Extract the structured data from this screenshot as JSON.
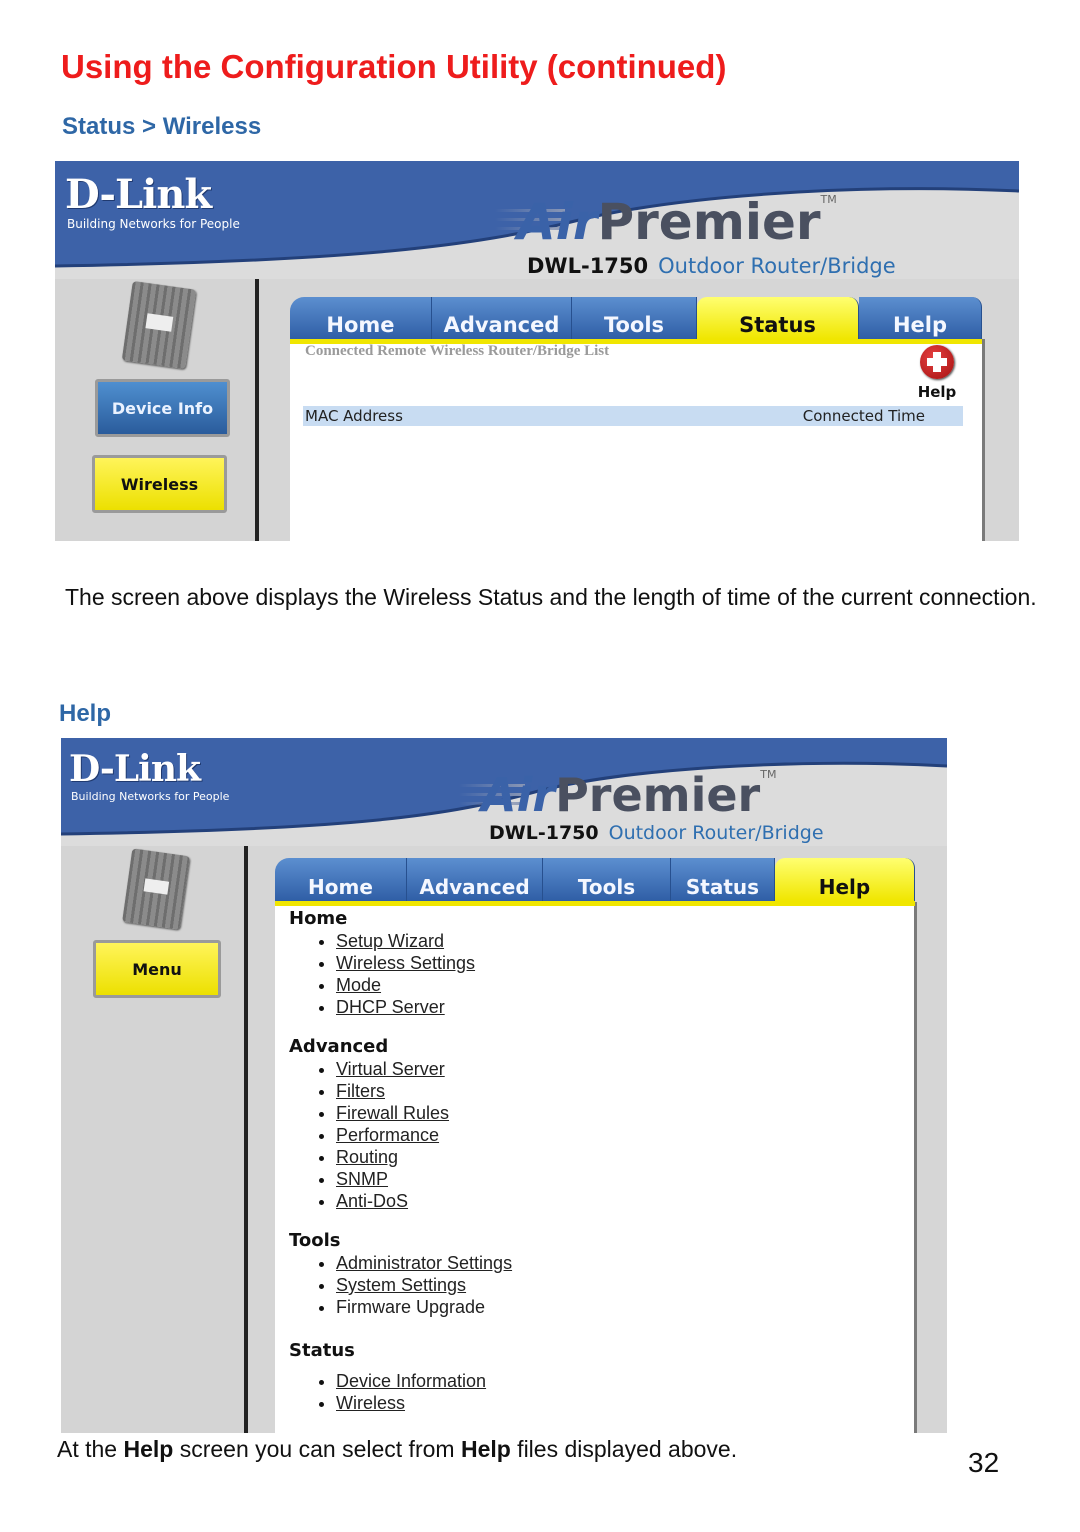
{
  "page": {
    "title": "Using the Configuration Utility (continued)",
    "page_number": "32"
  },
  "section1": {
    "heading": "Status > Wireless",
    "description": "The screen above displays the Wireless Status and the length of time of the current connection."
  },
  "section2": {
    "heading": "Help",
    "description_parts": [
      "At the ",
      "Help",
      " screen you can select from ",
      "Help",
      " files displayed above."
    ]
  },
  "brand": {
    "logo": "D-Link",
    "tagline": "Building Networks for People",
    "product_air": "Air",
    "product_premier": "Premier",
    "trademark": "TM",
    "model": "DWL-1750",
    "product_type": "Outdoor Router/Bridge"
  },
  "colors": {
    "title_red": "#ee1c1c",
    "heading_blue": "#2e67a6",
    "tab_blue": "#2f5ea6",
    "tab_active_yellow": "#f0e600",
    "table_header_bg": "#c8dcf2"
  },
  "screen1": {
    "side_buttons": [
      {
        "label": "Device Info",
        "style": "blue"
      },
      {
        "label": "Wireless",
        "style": "yellow"
      }
    ],
    "tabs": [
      {
        "label": "Home",
        "active": false
      },
      {
        "label": "Advanced",
        "active": false
      },
      {
        "label": "Tools",
        "active": false
      },
      {
        "label": "Status",
        "active": true
      },
      {
        "label": "Help",
        "active": false
      }
    ],
    "list_caption": "Connected Remote Wireless Router/Bridge List",
    "help_widget_label": "Help",
    "help_icon": "plus-help-icon",
    "table_columns": [
      "MAC Address",
      "Connected Time"
    ],
    "table_rows": []
  },
  "screen2": {
    "side_buttons": [
      {
        "label": "Menu",
        "style": "yellow"
      }
    ],
    "tabs": [
      {
        "label": "Home",
        "active": false
      },
      {
        "label": "Advanced",
        "active": false
      },
      {
        "label": "Tools",
        "active": false
      },
      {
        "label": "Status",
        "active": false
      },
      {
        "label": "Help",
        "active": true
      }
    ],
    "help_sections": [
      {
        "title": "Home",
        "items": [
          {
            "label": "Setup Wizard",
            "link": true
          },
          {
            "label": "Wireless Settings",
            "link": true
          },
          {
            "label": "Mode",
            "link": true
          },
          {
            "label": "DHCP Server",
            "link": true
          }
        ]
      },
      {
        "title": "Advanced",
        "items": [
          {
            "label": "Virtual Server",
            "link": true
          },
          {
            "label": "Filters",
            "link": true
          },
          {
            "label": "Firewall Rules",
            "link": true
          },
          {
            "label": "Performance",
            "link": true
          },
          {
            "label": "Routing",
            "link": true
          },
          {
            "label": "SNMP",
            "link": true
          },
          {
            "label": "Anti-DoS",
            "link": true
          }
        ]
      },
      {
        "title": "Tools",
        "items": [
          {
            "label": "Administrator Settings",
            "link": true
          },
          {
            "label": "System Settings",
            "link": true
          },
          {
            "label": "Firmware Upgrade",
            "link": false
          }
        ]
      },
      {
        "title": "Status",
        "items": [
          {
            "label": "Device Information",
            "link": true
          },
          {
            "label": "Wireless",
            "link": true
          }
        ]
      }
    ]
  }
}
